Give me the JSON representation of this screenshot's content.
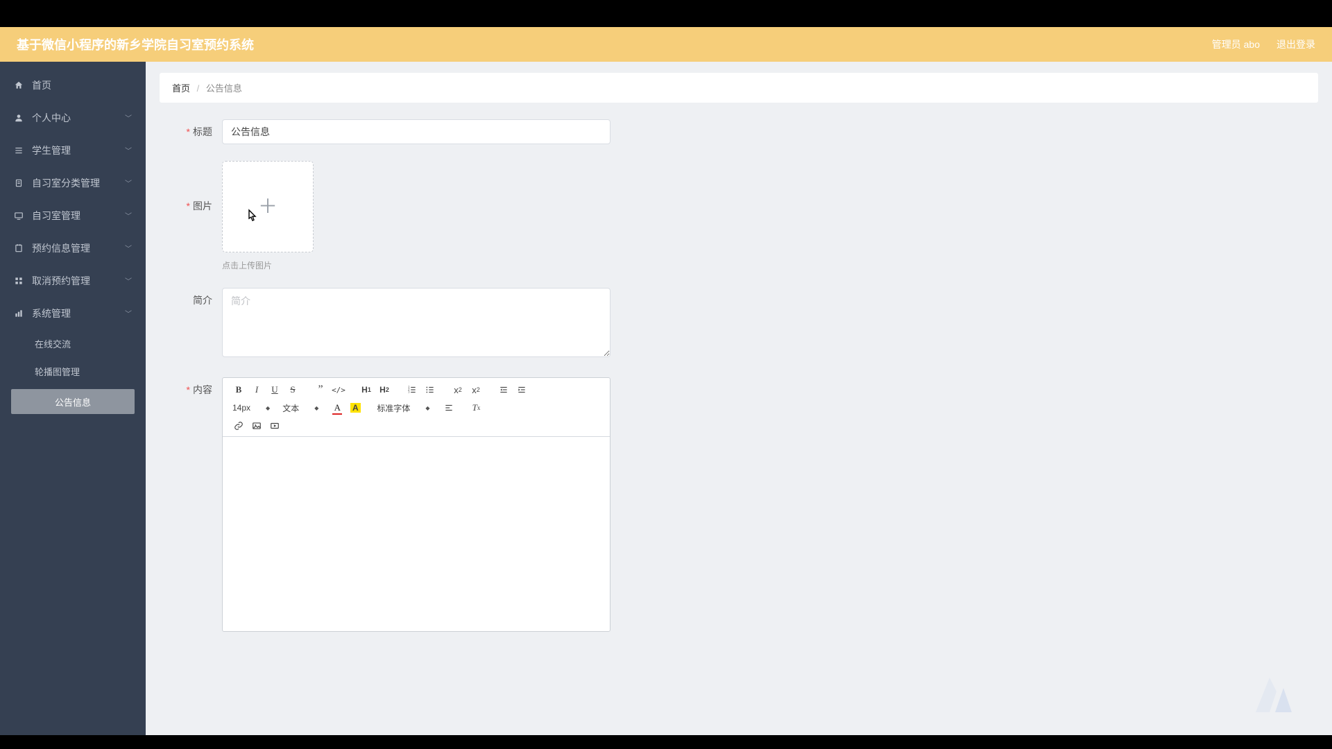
{
  "header": {
    "title": "基于微信小程序的新乡学院自习室预约系统",
    "user_label": "管理员 abo",
    "logout_label": "退出登录"
  },
  "sidebar": {
    "items": [
      {
        "icon": "home",
        "label": "首页",
        "expandable": false
      },
      {
        "icon": "user",
        "label": "个人中心",
        "expandable": true
      },
      {
        "icon": "list",
        "label": "学生管理",
        "expandable": true
      },
      {
        "icon": "clipboard",
        "label": "自习室分类管理",
        "expandable": true
      },
      {
        "icon": "monitor",
        "label": "自习室管理",
        "expandable": true
      },
      {
        "icon": "reserve",
        "label": "预约信息管理",
        "expandable": true
      },
      {
        "icon": "grid",
        "label": "取消预约管理",
        "expandable": true
      },
      {
        "icon": "bar",
        "label": "系统管理",
        "expandable": true
      }
    ],
    "submenu": [
      {
        "label": "在线交流",
        "active": false
      },
      {
        "label": "轮播图管理",
        "active": false
      },
      {
        "label": "公告信息",
        "active": true
      }
    ]
  },
  "breadcrumb": {
    "home": "首页",
    "current": "公告信息"
  },
  "form": {
    "title": {
      "label": "标题",
      "value": "公告信息",
      "required": true
    },
    "image": {
      "label": "图片",
      "hint": "点击上传图片",
      "required": true
    },
    "intro": {
      "label": "简介",
      "placeholder": "简介",
      "value": "",
      "required": false
    },
    "content": {
      "label": "内容",
      "required": true
    }
  },
  "editor": {
    "font_size": "14px",
    "block_type": "文本",
    "font_family": "标准字体"
  }
}
